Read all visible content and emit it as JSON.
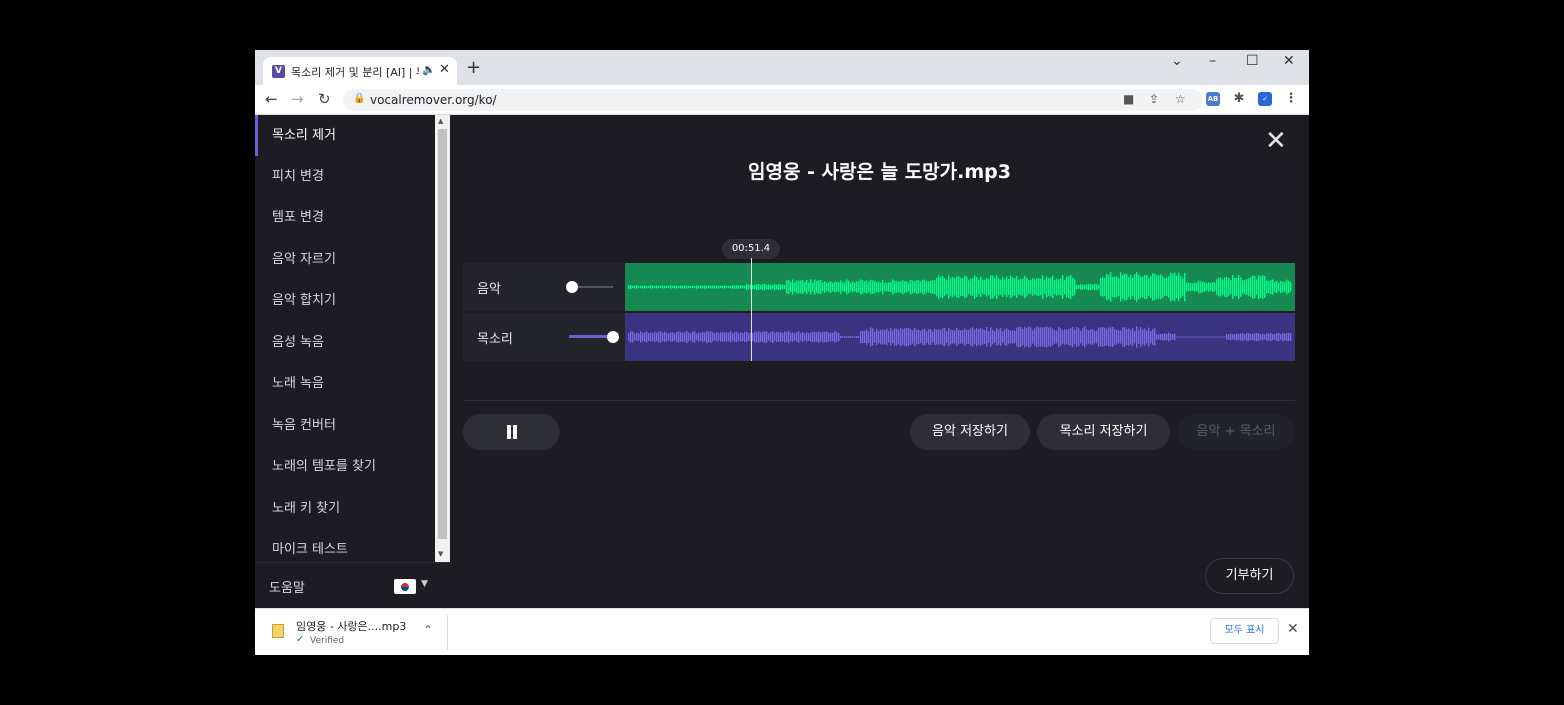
{
  "browser": {
    "tab_title": "목소리 제거 및 분리 [AI] | 무료 보컬 제거기",
    "tab_favicon_letter": "V",
    "url": "vocalremover.org/ko/"
  },
  "sidebar": {
    "items": [
      {
        "label": "목소리 제거",
        "active": true
      },
      {
        "label": "피치 변경"
      },
      {
        "label": "템포 변경"
      },
      {
        "label": "음악 자르기"
      },
      {
        "label": "음악 합치기"
      },
      {
        "label": "음성 녹음"
      },
      {
        "label": "노래 녹음"
      },
      {
        "label": "녹음 컨버터"
      },
      {
        "label": "노래의 템포를 찾기"
      },
      {
        "label": "노래 키 찾기"
      },
      {
        "label": "마이크 테스트"
      }
    ],
    "help_label": "도움말"
  },
  "player": {
    "title": "임영웅 - 사랑은 늘 도망가.mp3",
    "current_time": "00:51.4",
    "playhead_fraction": 0.19,
    "tracks": [
      {
        "label": "음악",
        "volume": 0.0,
        "color": "#00ff88",
        "bg": "#168a52"
      },
      {
        "label": "목소리",
        "volume": 1.0,
        "color": "#7a68e0",
        "bg": "#3a3480"
      }
    ],
    "save_music_label": "음악 저장하기",
    "save_voice_label": "목소리 저장하기",
    "save_both_label": "음악 + 목소리",
    "donate_label": "기부하기"
  },
  "downloads": {
    "file_name": "임영웅 - 사랑은....mp3",
    "status": "Verified",
    "show_all_label": "모두 표시"
  },
  "colors": {
    "accent": "#6d5fd8",
    "background": "#1c1c22"
  }
}
